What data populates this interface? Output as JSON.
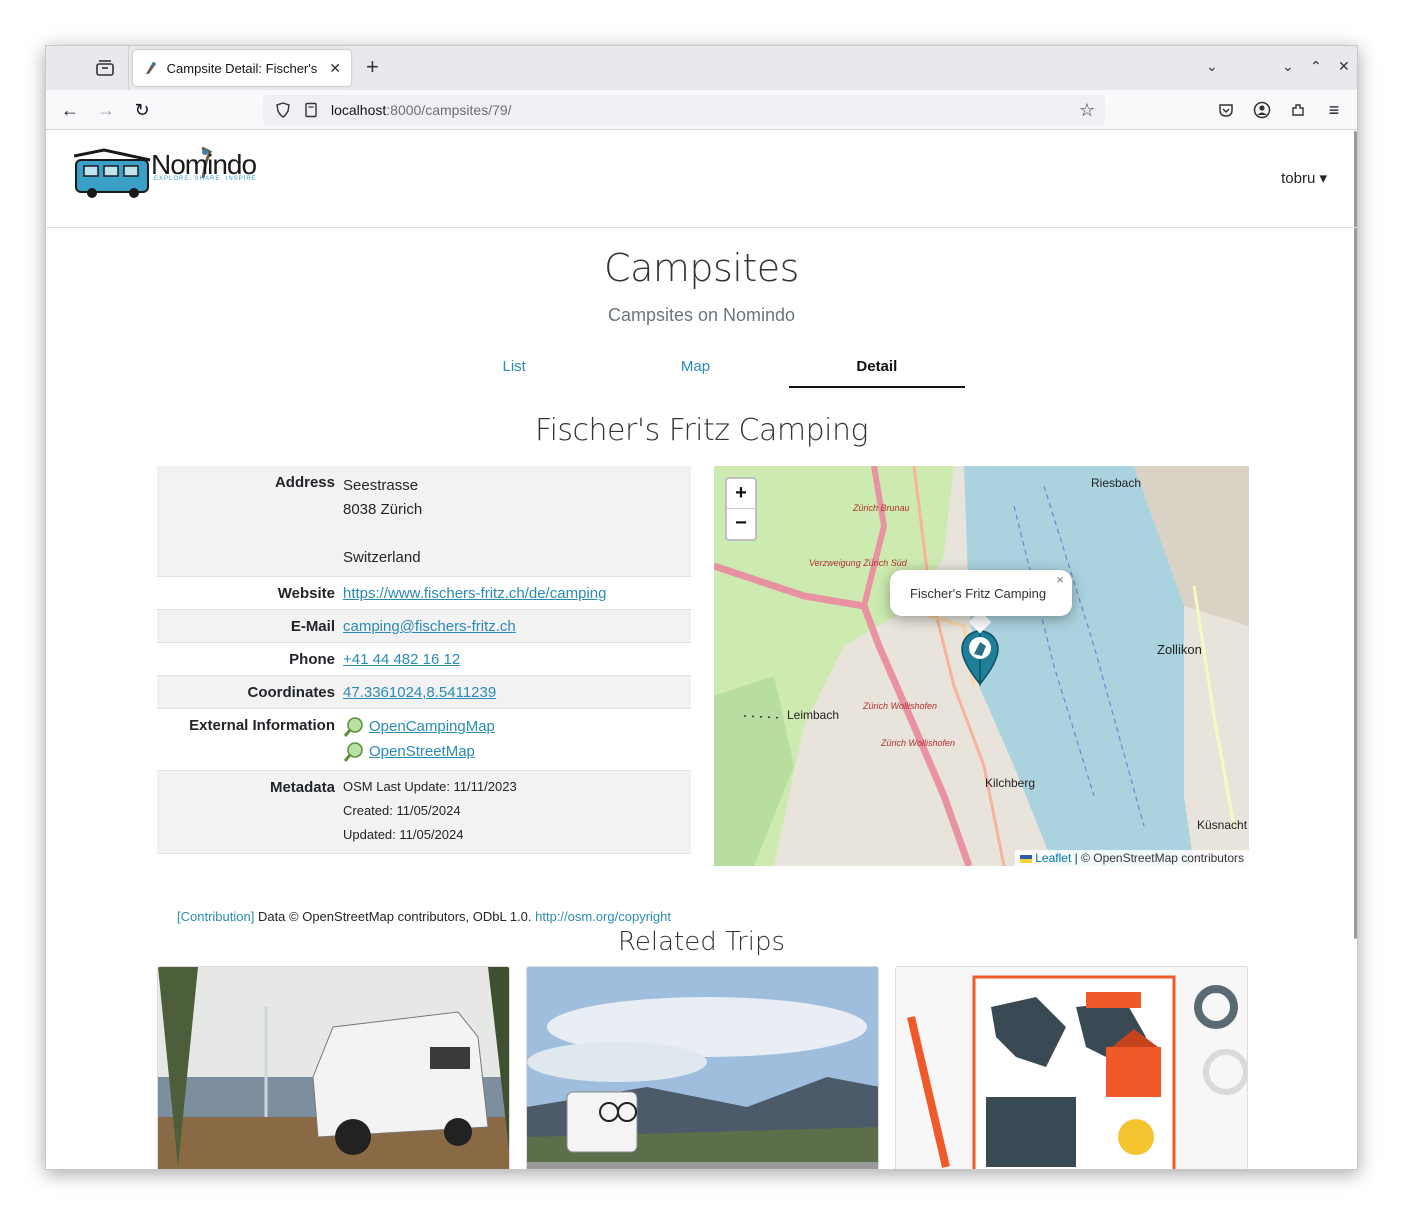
{
  "browser": {
    "tab_title": "Campsite Detail: Fischer's",
    "url_host": "localhost",
    "url_rest": ":8000/campsites/79/"
  },
  "site": {
    "logo_text": "Nomindo",
    "logo_tagline": "EXPLORE. SHARE. INSPIRE",
    "user": "tobru ▾"
  },
  "page": {
    "title": "Campsites",
    "subtitle": "Campsites on Nomindo",
    "tabs": [
      {
        "label": "List"
      },
      {
        "label": "Map"
      },
      {
        "label": "Detail"
      }
    ]
  },
  "campsite": {
    "name": "Fischer's Fritz Camping",
    "labels": {
      "address": "Address",
      "website": "Website",
      "email": "E-Mail",
      "phone": "Phone",
      "coordinates": "Coordinates",
      "external": "External Information",
      "metadata": "Metadata"
    },
    "address": {
      "street": "Seestrasse",
      "city": "8038 Zürich",
      "country": "Switzerland"
    },
    "website": "https://www.fischers-fritz.ch/de/camping",
    "email": "camping@fischers-fritz.ch",
    "phone": "+41 44 482 16 12",
    "coordinates": "47.3361024,8.5411239",
    "external_links": [
      "OpenCampingMap",
      "OpenStreetMap"
    ],
    "metadata": {
      "osm_update": "OSM Last Update: 11/11/2023",
      "created": "Created: 11/05/2024",
      "updated": "Updated: 11/05/2024"
    },
    "attribution": {
      "contribution": "[Contribution]",
      "text": " Data © OpenStreetMap contributors, ODbL 1.0. ",
      "link": "http://osm.org/copyright"
    }
  },
  "map": {
    "zoom_in": "+",
    "zoom_out": "−",
    "popup": "Fischer's Fritz Camping",
    "popup_close": "×",
    "attribution_leaflet": "Leaflet",
    "attribution_rest": " | © OpenStreetMap contributors",
    "places": [
      "Riesbach",
      "Zollikon",
      "Leimbach",
      "Kilchberg",
      "Küsnacht",
      "Zürich Brunau",
      "Verzweigung Zürich Süd",
      "Zürich Wollishofen"
    ]
  },
  "related": {
    "title": "Related Trips"
  },
  "colors": {
    "link": "#2a8bb5",
    "lake": "#aad3df",
    "greenery": "#cdebb0"
  }
}
